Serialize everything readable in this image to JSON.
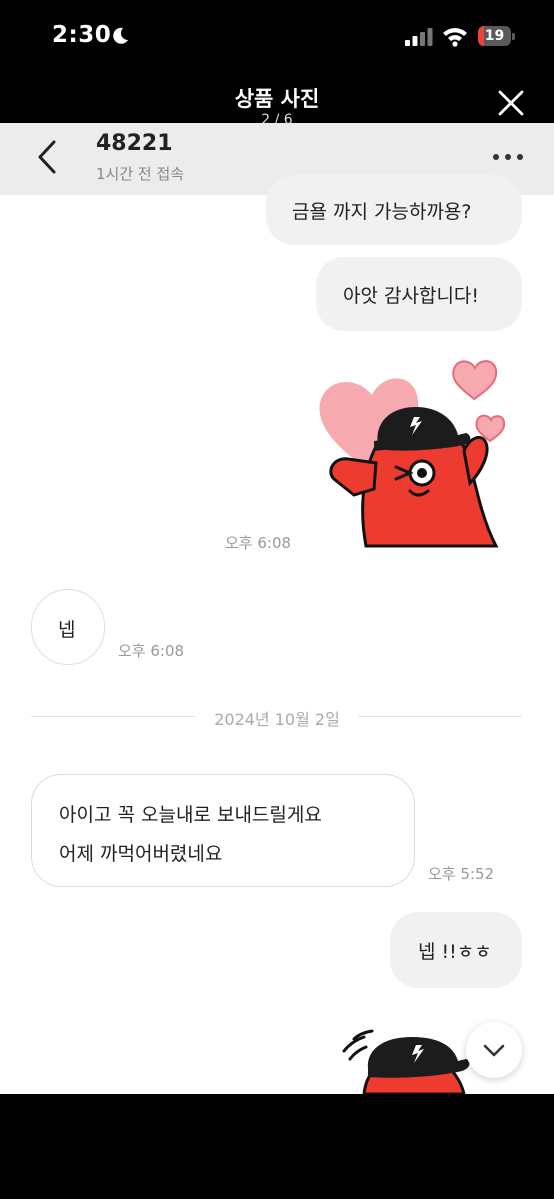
{
  "status_bar": {
    "time": "2:30",
    "battery_level": "19",
    "battery_fraction": 0.19,
    "battery_color": "#e8443a"
  },
  "viewer": {
    "title": "상품 사진",
    "counter": "2 / 6"
  },
  "chat": {
    "header": {
      "user_name": "48221",
      "presence": "1시간 전 접속"
    },
    "messages": {
      "m1_text": "금욜 까지 가능하까용?",
      "m2_text": "아앗 감사합니다!",
      "sticker1_time": "오후 6:08",
      "m3_text": "넵",
      "m3_time": "오후 6:08",
      "date_divider": "2024년 10월 2일",
      "m4_line1": "아이고 꼭 오늘내로 보내드릴게요",
      "m4_line2": "어제 까먹어버렸네요",
      "m4_time": "오후 5:52",
      "m5_text": "넵 !!ㅎㅎ"
    },
    "icons": {
      "back": "chevron-left-icon",
      "more": "more-horizontal-icon",
      "scroll_down": "chevron-down-icon",
      "sticker": "red-character-sticker"
    }
  }
}
